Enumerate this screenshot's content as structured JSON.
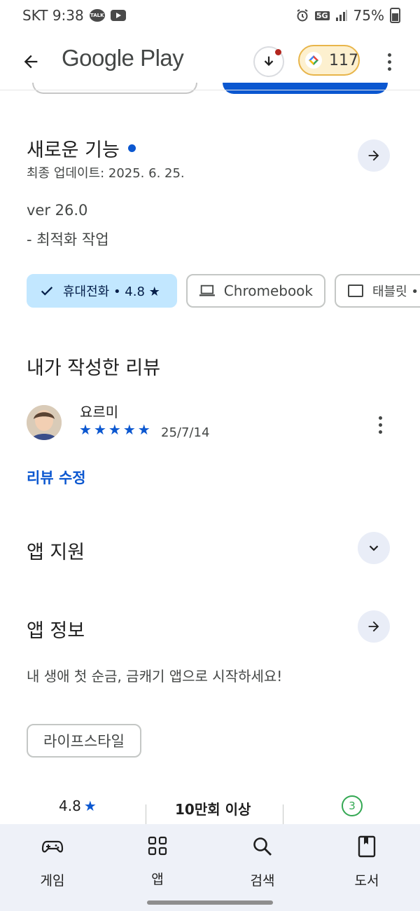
{
  "status": {
    "carrier_time": "SKT 9:38",
    "talk_badge": "TALK",
    "net": "5G",
    "battery": "75%"
  },
  "appbar": {
    "title": "Google Play",
    "points": "117"
  },
  "whats_new": {
    "title": "새로운 기능",
    "updated": "최종 업데이트: 2025. 6. 25.",
    "version": "ver 26.0",
    "note": "- 최적화 작업"
  },
  "device_chips": [
    {
      "label": "휴대전화 • 4.8 ★",
      "selected": true
    },
    {
      "label": "Chromebook"
    },
    {
      "label": "태블릿 •"
    }
  ],
  "my_review": {
    "title": "내가 작성한 리뷰",
    "reviewer": "요르미",
    "stars": 5,
    "date": "25/7/14",
    "edit_link": "리뷰 수정"
  },
  "app_support": {
    "title": "앱 지원"
  },
  "app_info": {
    "title": "앱 정보",
    "description": "내 생애 첫 순금, 금캐기 앱으로 시작하세요!",
    "category": "라이프스타일"
  },
  "stats": {
    "rating": "4.8",
    "downloads": "10만회 이상",
    "age_rating": "3"
  },
  "bottom_nav": [
    {
      "label": "게임",
      "icon": "gamepad-icon"
    },
    {
      "label": "앱",
      "icon": "apps-grid-icon"
    },
    {
      "label": "검색",
      "icon": "search-icon"
    },
    {
      "label": "도서",
      "icon": "book-icon"
    }
  ],
  "colors": {
    "accent": "#0b57d0",
    "selected_chip": "#c2e7ff",
    "points_bg": "#fdf0cf",
    "nav_bg": "#eef1f8"
  }
}
